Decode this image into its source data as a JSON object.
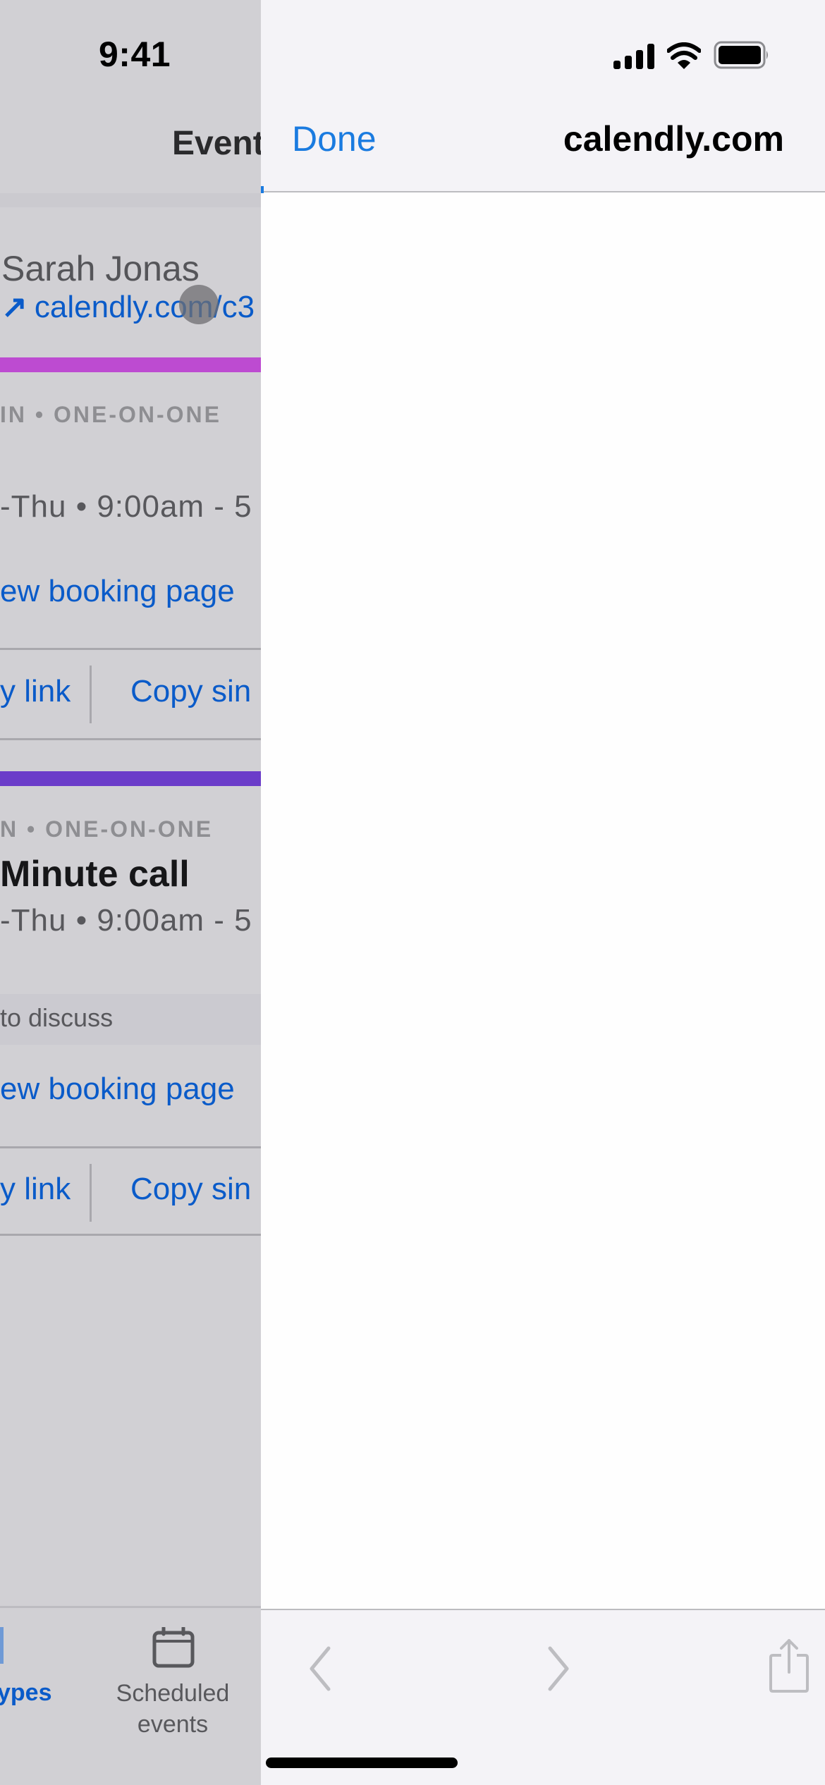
{
  "status_bar": {
    "time": "9:41",
    "icons": [
      "cellular-signal-icon",
      "wifi-icon",
      "battery-icon"
    ]
  },
  "background_app": {
    "nav_title": "Event",
    "owner": {
      "name": "Sarah Jonas",
      "link_icon": "arrow-up-right-icon",
      "link_text": "calendly.com/c3"
    },
    "event_cards": [
      {
        "accent_color": "#bd4bd1",
        "kind": "IN • ONE-ON-ONE",
        "title": "",
        "hours": "-Thu • 9:00am - 5",
        "description": "",
        "booking_link": "ew booking page",
        "copy_link": "y link",
        "copy_single": "Copy sin"
      },
      {
        "accent_color": "#6b3cc9",
        "kind": "N • ONE-ON-ONE",
        "title": "Minute call",
        "hours": "-Thu • 9:00am - 5",
        "description": "to discuss",
        "booking_link": "ew booking page",
        "copy_link": "y link",
        "copy_single": "Copy sin"
      }
    ],
    "tab_bar": {
      "items": [
        {
          "label": "ypes",
          "icon": "event-types-icon",
          "active": true
        },
        {
          "label": "Scheduled events",
          "icon": "calendar-icon",
          "active": false
        }
      ]
    }
  },
  "web_sheet": {
    "done_label": "Done",
    "domain": "calendly.com",
    "toolbar": {
      "back": "chevron-left-icon",
      "forward": "chevron-right-icon",
      "share": "share-icon"
    }
  },
  "colors": {
    "link_blue": "#0a5bc9",
    "ios_blue": "#1a7be0",
    "dim_overlay": "#d1d0d4",
    "sheet_chrome": "#f4f3f7"
  }
}
